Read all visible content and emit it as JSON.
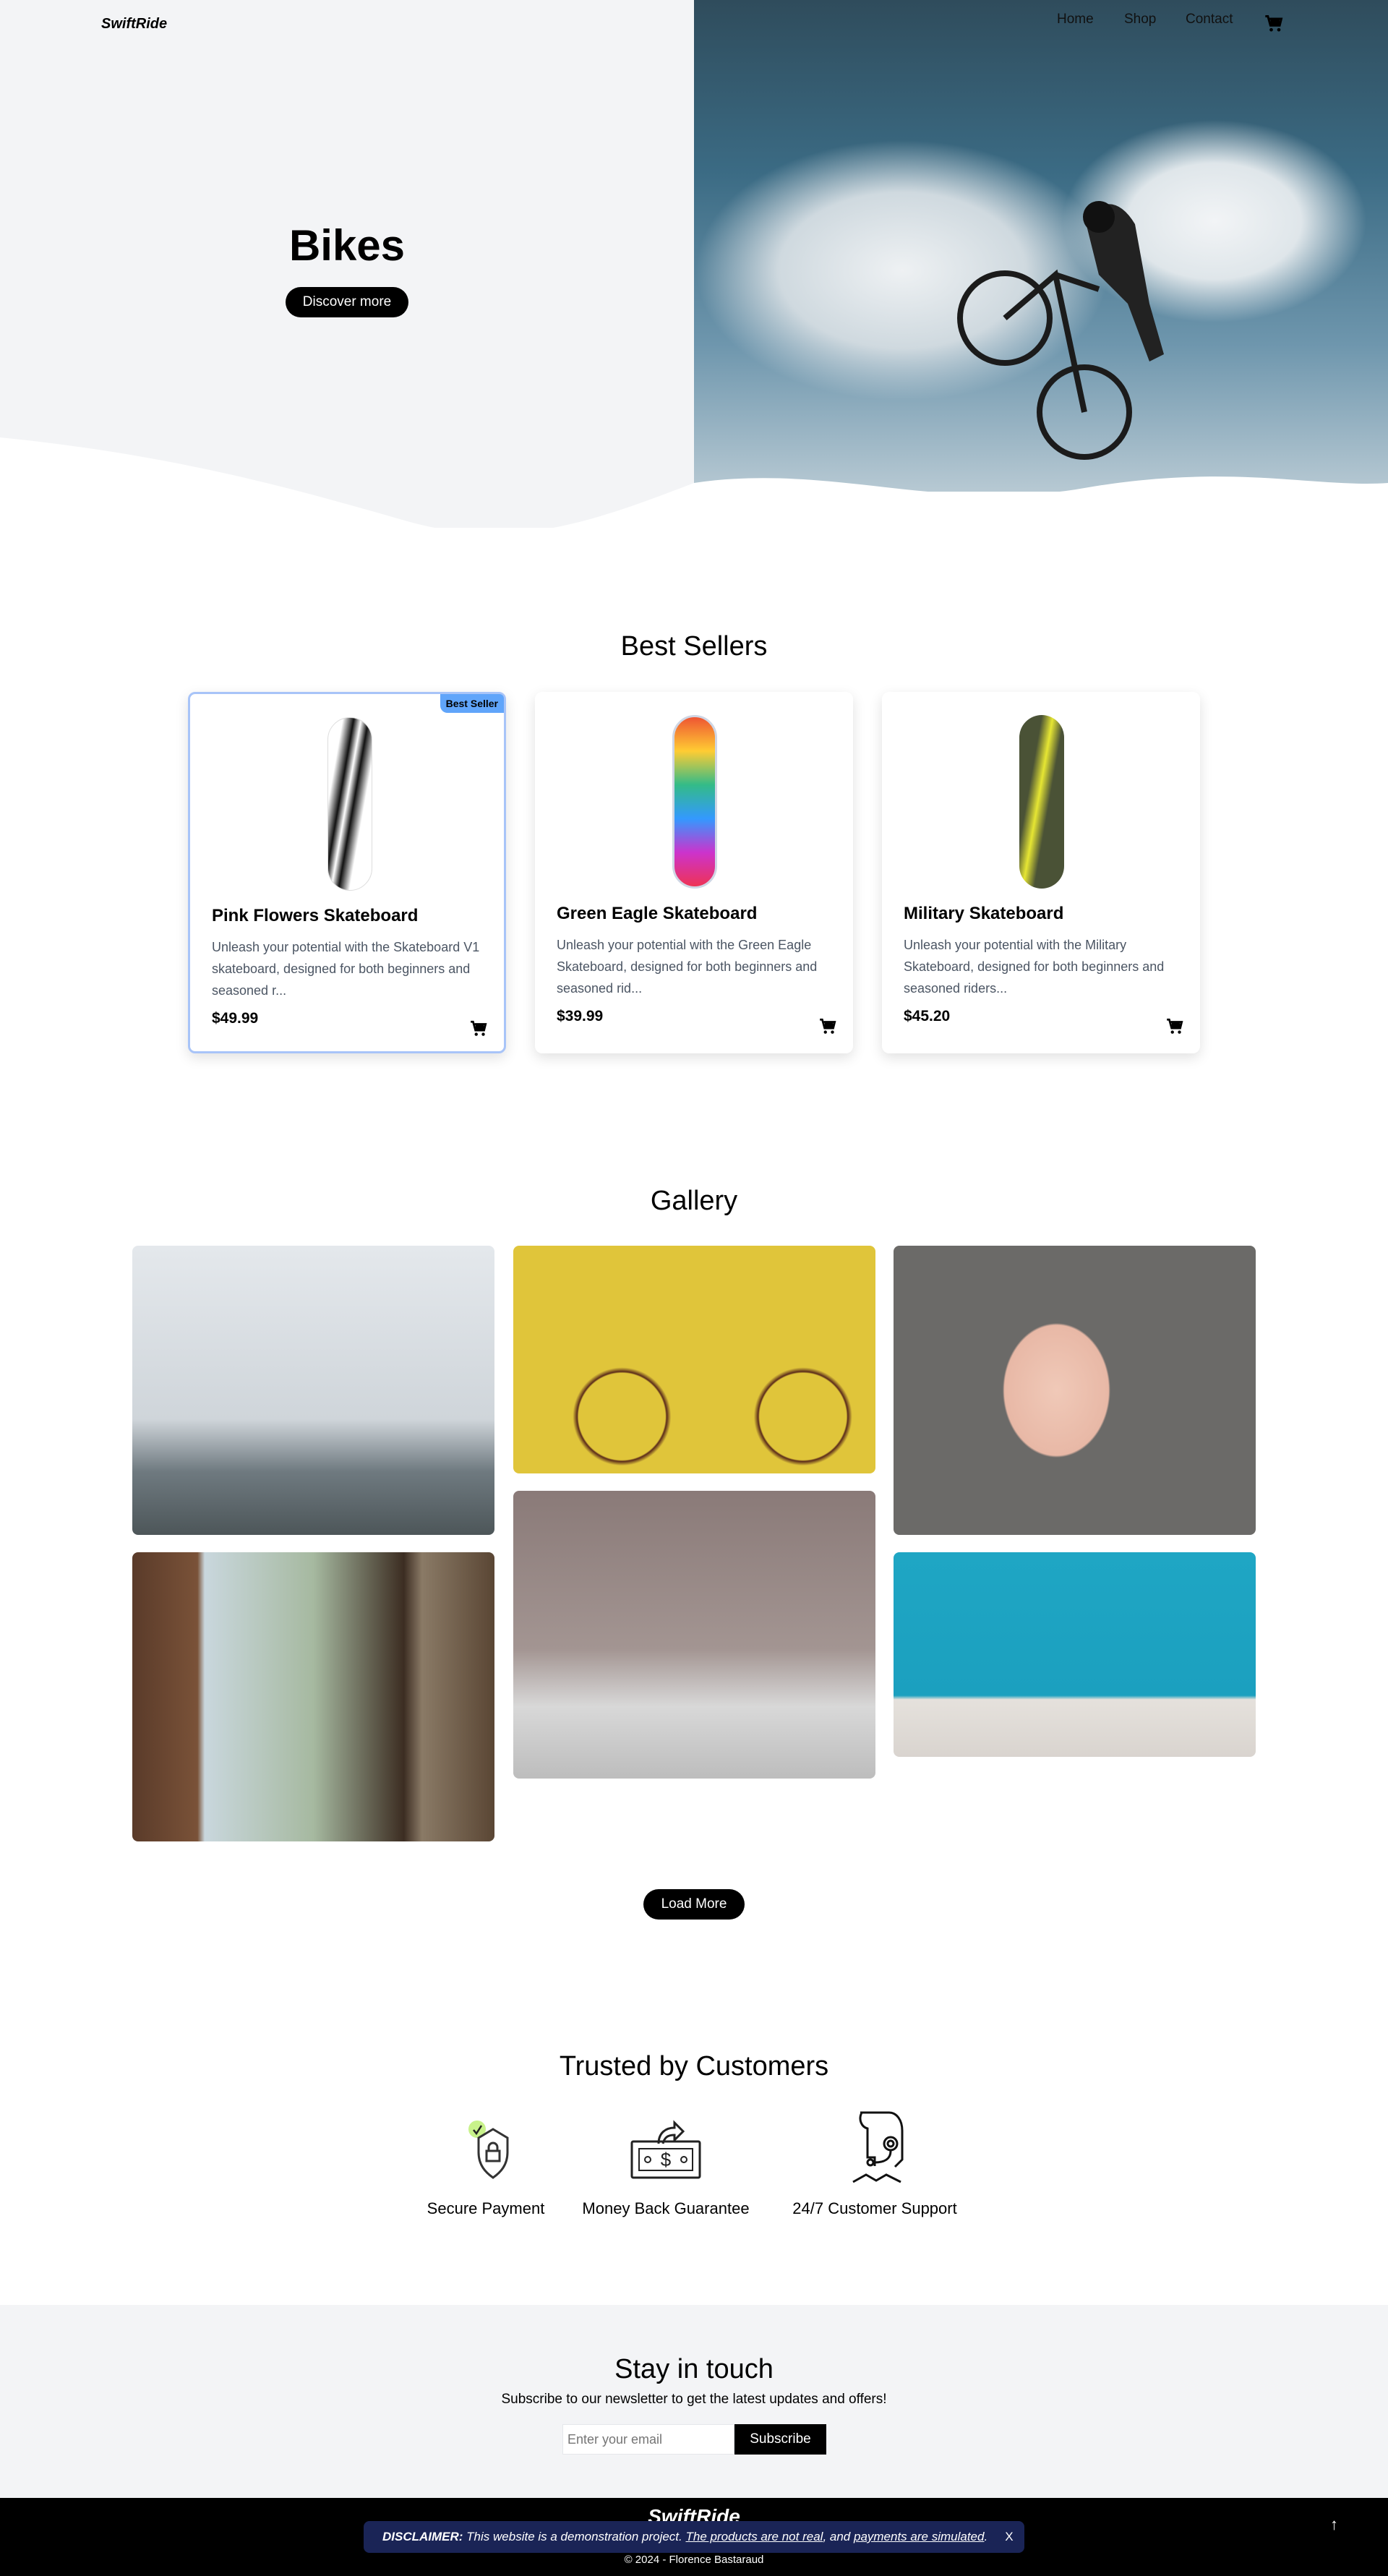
{
  "header": {
    "logo": "SwiftRide",
    "nav": [
      "Home",
      "Shop",
      "Contact"
    ],
    "cart_icon": "cart-icon"
  },
  "hero": {
    "title": "Bikes",
    "button": "Discover more"
  },
  "best_sellers": {
    "title": "Best Sellers",
    "products": [
      {
        "name": "Pink Flowers Skateboard",
        "description": "Unleash your potential with the Skateboard V1 skateboard, designed for both beginners and seasoned r...",
        "price": "$49.99",
        "badge": "Best Seller"
      },
      {
        "name": "Green Eagle Skateboard",
        "description": "Unleash your potential with the Green Eagle Skateboard, designed for both beginners and seasoned rid...",
        "price": "$39.99"
      },
      {
        "name": "Military Skateboard",
        "description": "Unleash your potential with the Military Skateboard, designed for both beginners and seasoned riders...",
        "price": "$45.20"
      }
    ]
  },
  "gallery": {
    "title": "Gallery",
    "load_more": "Load More"
  },
  "trust": {
    "title": "Trusted by Customers",
    "items": [
      {
        "label": "Secure Payment",
        "icon": "shield-lock-icon"
      },
      {
        "label": "Money Back Guarantee",
        "icon": "money-back-icon"
      },
      {
        "label": "24/7 Customer Support",
        "icon": "headset-support-icon"
      }
    ]
  },
  "newsletter": {
    "title": "Stay in touch",
    "text": "Subscribe to our newsletter to get the latest updates and offers!",
    "placeholder": "Enter your email",
    "button": "Subscribe"
  },
  "footer": {
    "logo": "SwiftRide",
    "copyright": "© 2024 - Florence Bastaraud",
    "scroll_top": "↑"
  },
  "disclaimer": {
    "label": "DISCLAIMER:",
    "text": " This website is a demonstration project. ",
    "link1": "The products are not real",
    "mid": ", and ",
    "link2": "payments are simulated",
    "end": ".",
    "close": "X",
    "color": "#1a2456"
  },
  "colors": {
    "accent": "#60a5fa",
    "hero_bg": "#f3f4f6"
  }
}
